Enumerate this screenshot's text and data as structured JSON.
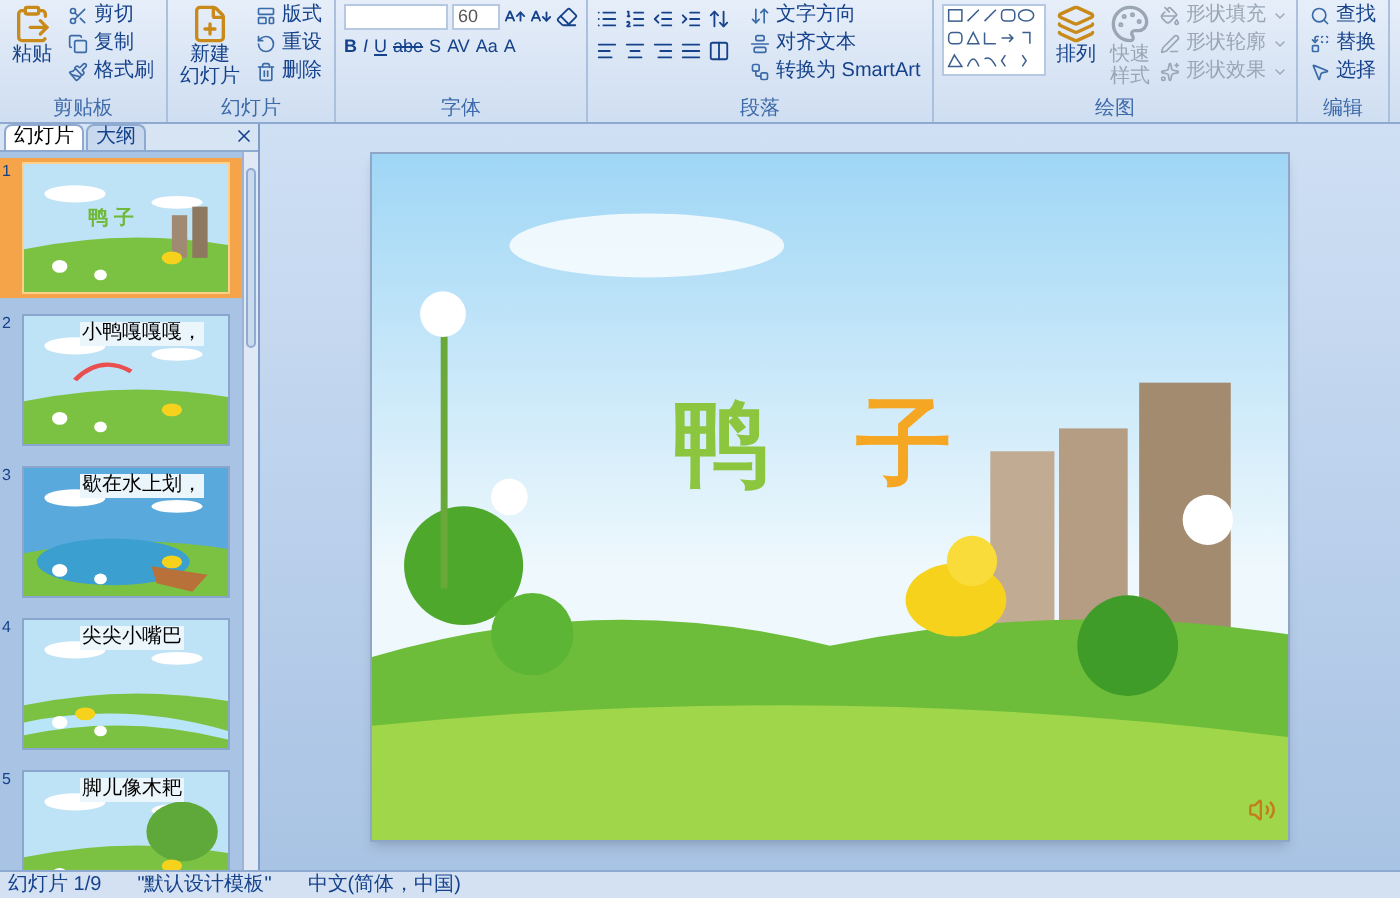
{
  "ribbon": {
    "groups": [
      {
        "kind": "clipboard",
        "label": "剪贴板",
        "big": [
          "粘贴"
        ],
        "items": [
          "剪切",
          "复制",
          "格式刷"
        ]
      },
      {
        "kind": "slides",
        "label": "幻灯片",
        "big": [
          "新建",
          "幻灯片"
        ],
        "items": [
          "版式",
          "重设",
          "删除"
        ]
      },
      {
        "kind": "font",
        "label": "字体",
        "size": "60",
        "buttons": [
          "B",
          "I",
          "U",
          "abe",
          "S",
          "AV",
          "Aa",
          "A"
        ]
      },
      {
        "kind": "paragraph",
        "label": "段落",
        "items": [
          "文字方向",
          "对齐文本",
          "转换为 SmartArt"
        ]
      },
      {
        "kind": "drawing",
        "label": "绘图",
        "big": [
          "排列"
        ],
        "quick": {
          "lines": [
            "快速",
            "样式"
          ],
          "disabled": true
        },
        "shape_items": [
          {
            "label": "形状填充",
            "disabled": true
          },
          {
            "label": "形状轮廓",
            "disabled": true
          },
          {
            "label": "形状效果",
            "disabled": true
          }
        ]
      },
      {
        "kind": "editing",
        "label": "编辑",
        "items": [
          "查找",
          "替换",
          "选择"
        ]
      }
    ]
  },
  "pane": {
    "tabs": [
      {
        "label": "幻灯片",
        "selected": true
      },
      {
        "label": "大纲",
        "selected": false
      }
    ],
    "slides": [
      {
        "number": "1",
        "text": "鸭 子",
        "selected": true
      },
      {
        "number": "2",
        "text": "小鸭嘎嘎嘎，",
        "selected": false
      },
      {
        "number": "3",
        "text": "歇在水上划，",
        "selected": false
      },
      {
        "number": "4",
        "text": "尖尖小嘴巴",
        "selected": false
      },
      {
        "number": "5",
        "text": "脚儿像木耙",
        "selected": false
      }
    ]
  },
  "slide": {
    "title": [
      {
        "text": "鸭",
        "color": "#8cc63f"
      },
      {
        "text": "子",
        "color": "#f5a623"
      }
    ]
  },
  "status_bar": [
    "幻灯片 1/9",
    "\"默认设计模板\"",
    "中文(简体，中国)"
  ]
}
